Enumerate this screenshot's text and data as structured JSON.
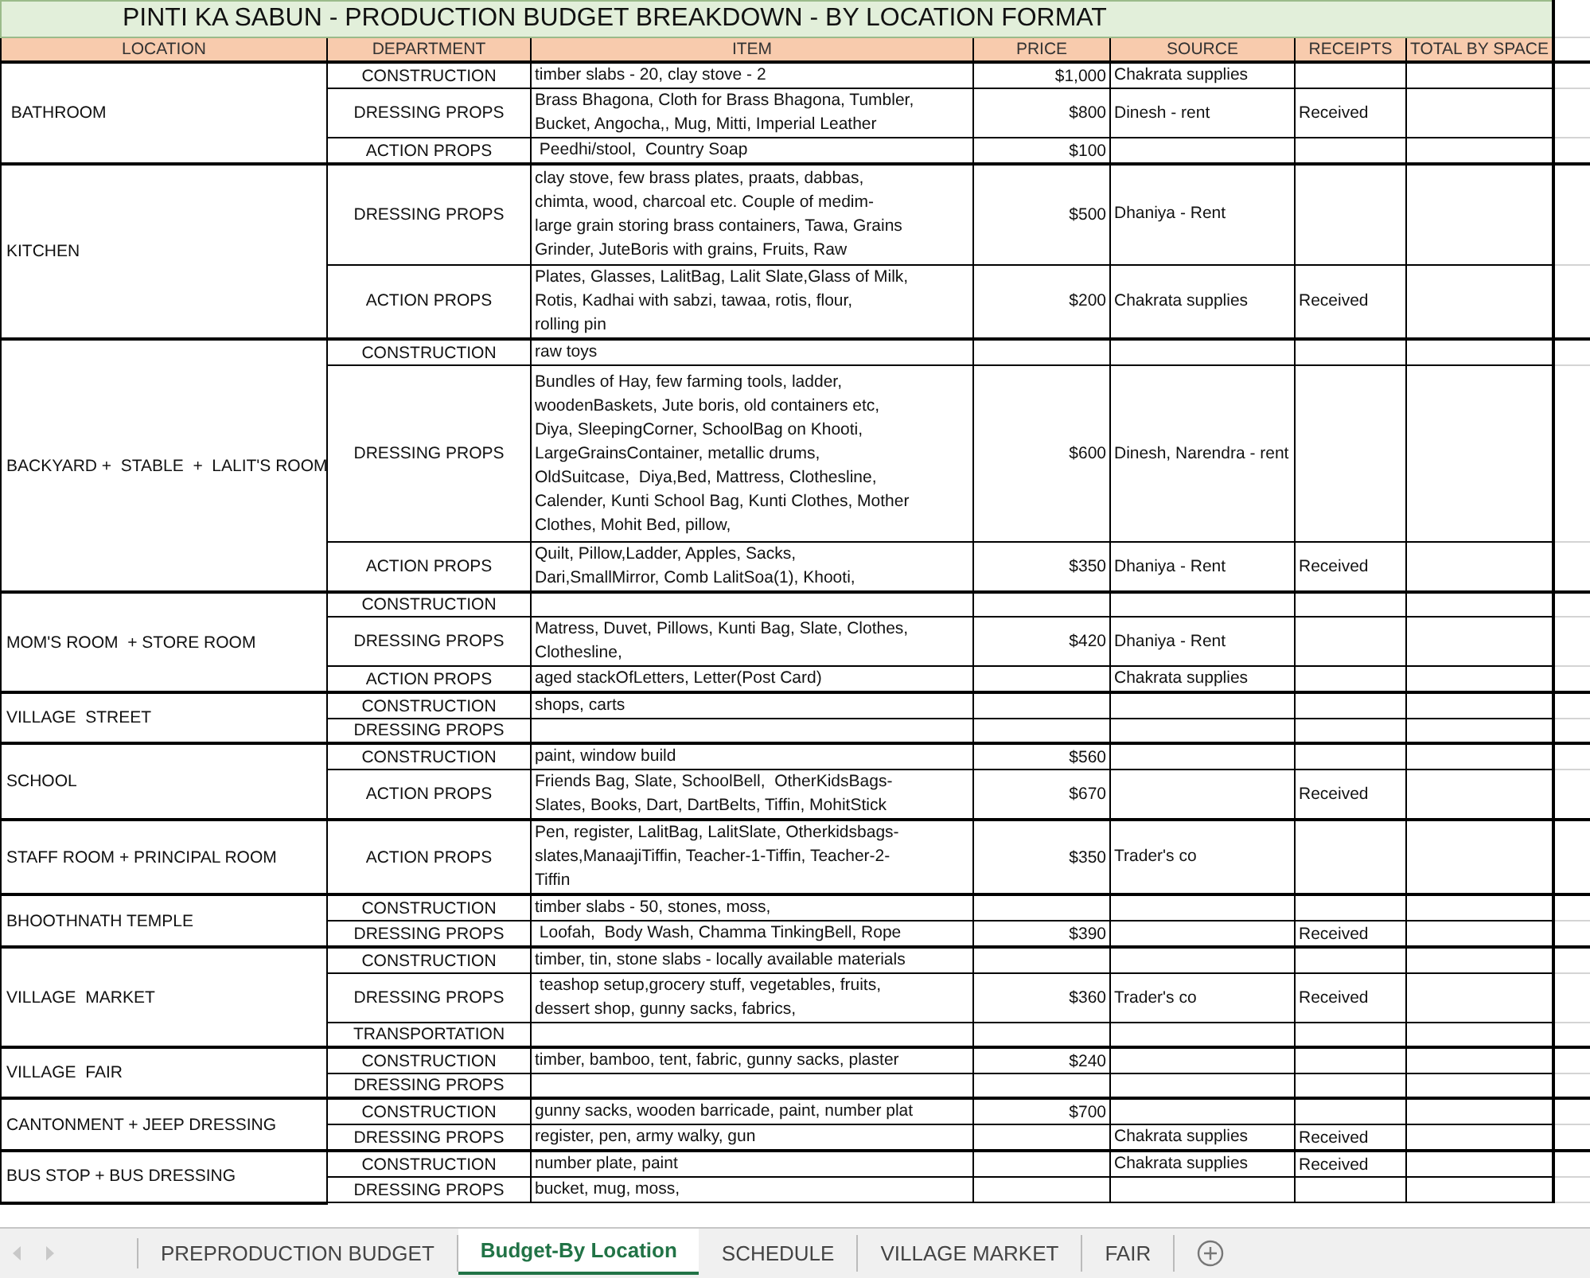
{
  "title": "PINTI KA SABUN - PRODUCTION BUDGET BREAKDOWN - BY LOCATION FORMAT",
  "columns": [
    "LOCATION",
    "DEPARTMENT",
    "ITEM",
    "PRICE",
    "SOURCE",
    "RECEIPTS",
    "TOTAL BY SPACE"
  ],
  "locations": [
    {
      "name": " BATHROOM",
      "rows": [
        {
          "department": "CONSTRUCTION",
          "item": [
            "timber slabs - 20, clay stove - 2"
          ],
          "price": "$1,000",
          "source": "Chakrata supplies"
        },
        {
          "department": "DRESSING PROPS",
          "item": [
            "Brass Bhagona, Cloth for Brass Bhagona, Tumbler,",
            "Bucket, Angocha,, Mug, Mitti, Imperial Leather"
          ],
          "price": "$800",
          "source": "Dinesh - rent",
          "receipts": "Received"
        },
        {
          "department": "ACTION PROPS",
          "item": [
            " Peedhi/stool,  Country Soap"
          ],
          "price": "$100"
        }
      ]
    },
    {
      "name": "KITCHEN",
      "rows": [
        {
          "department": "DRESSING PROPS",
          "item": [
            "clay stove, few brass plates, praats, dabbas,",
            "chimta, wood, charcoal etc. Couple of medim-",
            "large grain storing brass containers, Tawa, Grains",
            "Grinder, JuteBoris with grains, Fruits, Raw"
          ],
          "price": "$500",
          "source": "Dhaniya - Rent"
        },
        {
          "department": "ACTION PROPS",
          "item": [
            "Plates, Glasses, LalitBag, Lalit Slate,Glass of Milk,",
            "Rotis, Kadhai with sabzi, tawaa, rotis, flour,",
            "rolling pin"
          ],
          "price": "$200",
          "source": "Chakrata supplies",
          "receipts": "Received"
        }
      ]
    },
    {
      "name": "BACKYARD +  STABLE  +  LALIT'S ROOM",
      "rows": [
        {
          "department": "CONSTRUCTION",
          "item": [
            "raw toys"
          ]
        },
        {
          "department": "DRESSING PROPS",
          "item": [
            "Bundles of Hay, few farming tools, ladder,",
            "woodenBaskets, Jute boris, old containers etc,",
            "Diya, SleepingCorner, SchoolBag on Khooti,",
            "LargeGrainsContainer, metallic drums,",
            "OldSuitcase,  Diya,Bed, Mattress, Clothesline,",
            "Calender, Kunti School Bag, Kunti Clothes, Mother",
            "Clothes, Mohit Bed, pillow,"
          ],
          "price": "$600",
          "source": "Dinesh, Narendra - rent"
        },
        {
          "department": "ACTION PROPS",
          "item": [
            "Quilt, Pillow,Ladder, Apples, Sacks,",
            "Dari,SmallMirror, Comb LalitSoa(1), Khooti,"
          ],
          "price": "$350",
          "source": "Dhaniya - Rent",
          "receipts": "Received"
        }
      ]
    },
    {
      "name": "MOM'S ROOM  + STORE ROOM",
      "rows": [
        {
          "department": "CONSTRUCTION",
          "item": []
        },
        {
          "department": "DRESSING PROPS",
          "item": [
            "Matress, Duvet, Pillows, Kunti Bag, Slate, Clothes,",
            "Clothesline,"
          ],
          "price": "$420",
          "source": "Dhaniya - Rent"
        },
        {
          "department": "ACTION PROPS",
          "item": [
            "aged stackOfLetters, Letter(Post Card)"
          ],
          "source": "Chakrata supplies"
        }
      ]
    },
    {
      "name": "VILLAGE  STREET",
      "rows": [
        {
          "department": "CONSTRUCTION",
          "item": [
            "shops, carts"
          ]
        },
        {
          "department": "DRESSING PROPS",
          "item": []
        }
      ]
    },
    {
      "name": "SCHOOL",
      "rows": [
        {
          "department": "CONSTRUCTION",
          "item": [
            "paint, window build"
          ],
          "price": "$560"
        },
        {
          "department": "ACTION PROPS",
          "item": [
            "Friends Bag, Slate, SchoolBell,  OtherKidsBags-",
            "Slates, Books, Dart, DartBelts, Tiffin, MohitStick"
          ],
          "price": "$670",
          "receipts": "Received"
        }
      ]
    },
    {
      "name": "STAFF ROOM + PRINCIPAL ROOM",
      "rows": [
        {
          "department": "ACTION PROPS",
          "item": [
            "Pen, register, LalitBag, LalitSlate, Otherkidsbags-",
            "slates,ManaajiTiffin, Teacher-1-Tiffin, Teacher-2-",
            "Tiffin"
          ],
          "price": "$350",
          "source": "Trader's co"
        }
      ]
    },
    {
      "name": "BHOOTHNATH TEMPLE",
      "rows": [
        {
          "department": "CONSTRUCTION",
          "item": [
            "timber slabs - 50, stones, moss,"
          ]
        },
        {
          "department": "DRESSING PROPS",
          "item": [
            " Loofah,  Body Wash, Chamma TinkingBell, Rope"
          ],
          "price": "$390",
          "receipts": "Received"
        }
      ]
    },
    {
      "name": "VILLAGE  MARKET",
      "rows": [
        {
          "department": "CONSTRUCTION",
          "item": [
            "timber, tin, stone slabs - locally available materials"
          ]
        },
        {
          "department": "DRESSING PROPS",
          "item": [
            " teashop setup,grocery stuff, vegetables, fruits,",
            "dessert shop, gunny sacks, fabrics,"
          ],
          "price": "$360",
          "source": "Trader's co",
          "receipts": "Received"
        },
        {
          "department": "TRANSPORTATION",
          "item": []
        }
      ]
    },
    {
      "name": "VILLAGE  FAIR",
      "rows": [
        {
          "department": "CONSTRUCTION",
          "item": [
            "timber, bamboo, tent, fabric, gunny sacks, plaster"
          ],
          "price": "$240"
        },
        {
          "department": "DRESSING PROPS",
          "item": []
        }
      ]
    },
    {
      "name": "CANTONMENT + JEEP DRESSING",
      "rows": [
        {
          "department": "CONSTRUCTION",
          "item": [
            "gunny sacks, wooden barricade, paint, number plat"
          ],
          "price": "$700"
        },
        {
          "department": "DRESSING PROPS",
          "item": [
            "register, pen, army walky, gun"
          ],
          "source": "Chakrata supplies",
          "receipts": "Received"
        }
      ]
    },
    {
      "name": "BUS STOP + BUS DRESSING",
      "rows": [
        {
          "department": "CONSTRUCTION",
          "item": [
            "number plate, paint"
          ],
          "source": "Chakrata supplies",
          "receipts": "Received"
        },
        {
          "department": "DRESSING PROPS",
          "item": [
            "bucket, mug, moss,"
          ]
        }
      ]
    }
  ],
  "sheet_tabs": [
    {
      "label": "PREPRODUCTION BUDGET",
      "selected": false
    },
    {
      "label": "Budget-By Location",
      "selected": true
    },
    {
      "label": "SCHEDULE",
      "selected": false
    },
    {
      "label": "VILLAGE MARKET",
      "selected": false
    },
    {
      "label": "FAIR",
      "selected": false
    }
  ]
}
